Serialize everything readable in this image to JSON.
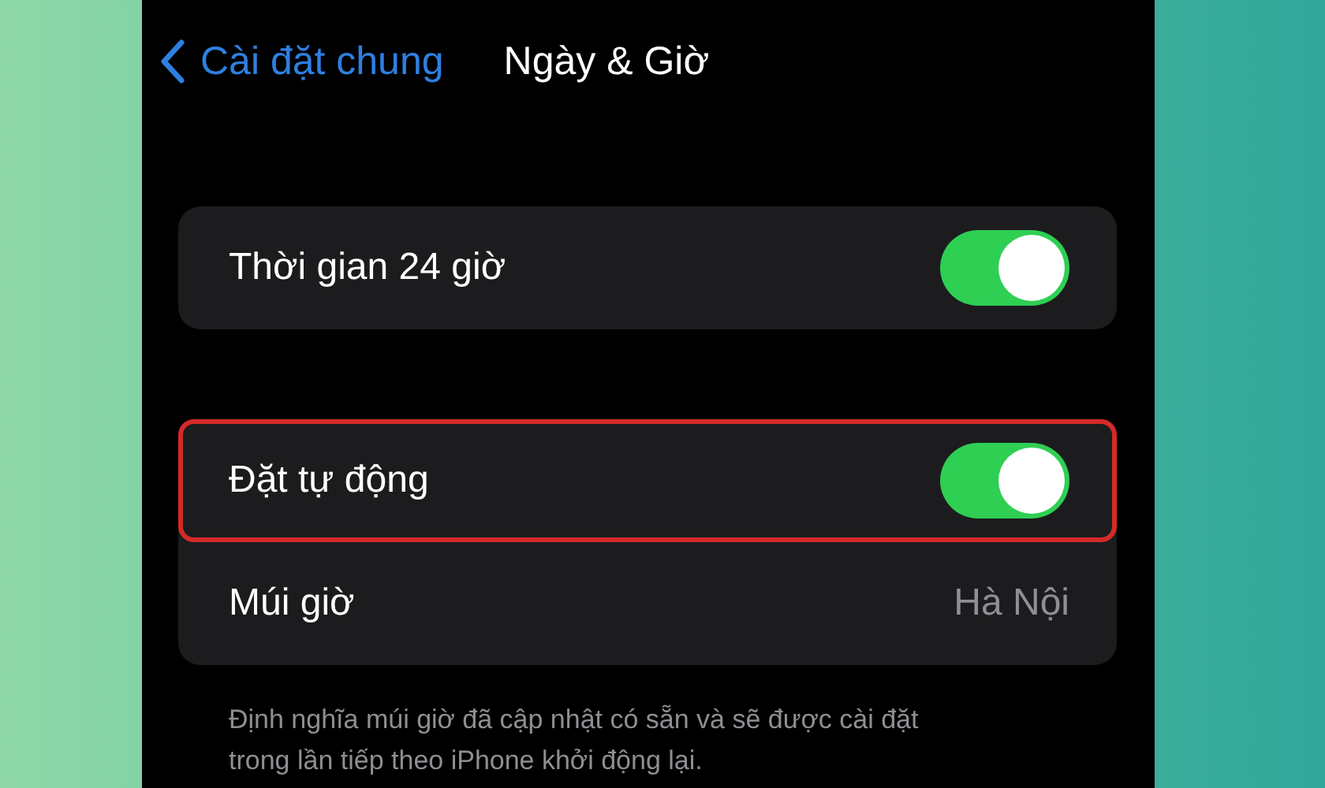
{
  "nav": {
    "back_label": "Cài đặt chung",
    "title": "Ngày & Giờ"
  },
  "groups": [
    {
      "rows": [
        {
          "kind": "toggle",
          "label": "Thời gian 24 giờ",
          "on": true,
          "highlighted": false
        }
      ]
    },
    {
      "rows": [
        {
          "kind": "toggle",
          "label": "Đặt tự động",
          "on": true,
          "highlighted": true
        },
        {
          "kind": "value",
          "label": "Múi giờ",
          "value": "Hà Nội",
          "highlighted": false
        }
      ]
    }
  ],
  "footer": "Định nghĩa múi giờ đã cập nhật có sẵn và sẽ được cài đặt trong lần tiếp theo iPhone khởi động lại."
}
